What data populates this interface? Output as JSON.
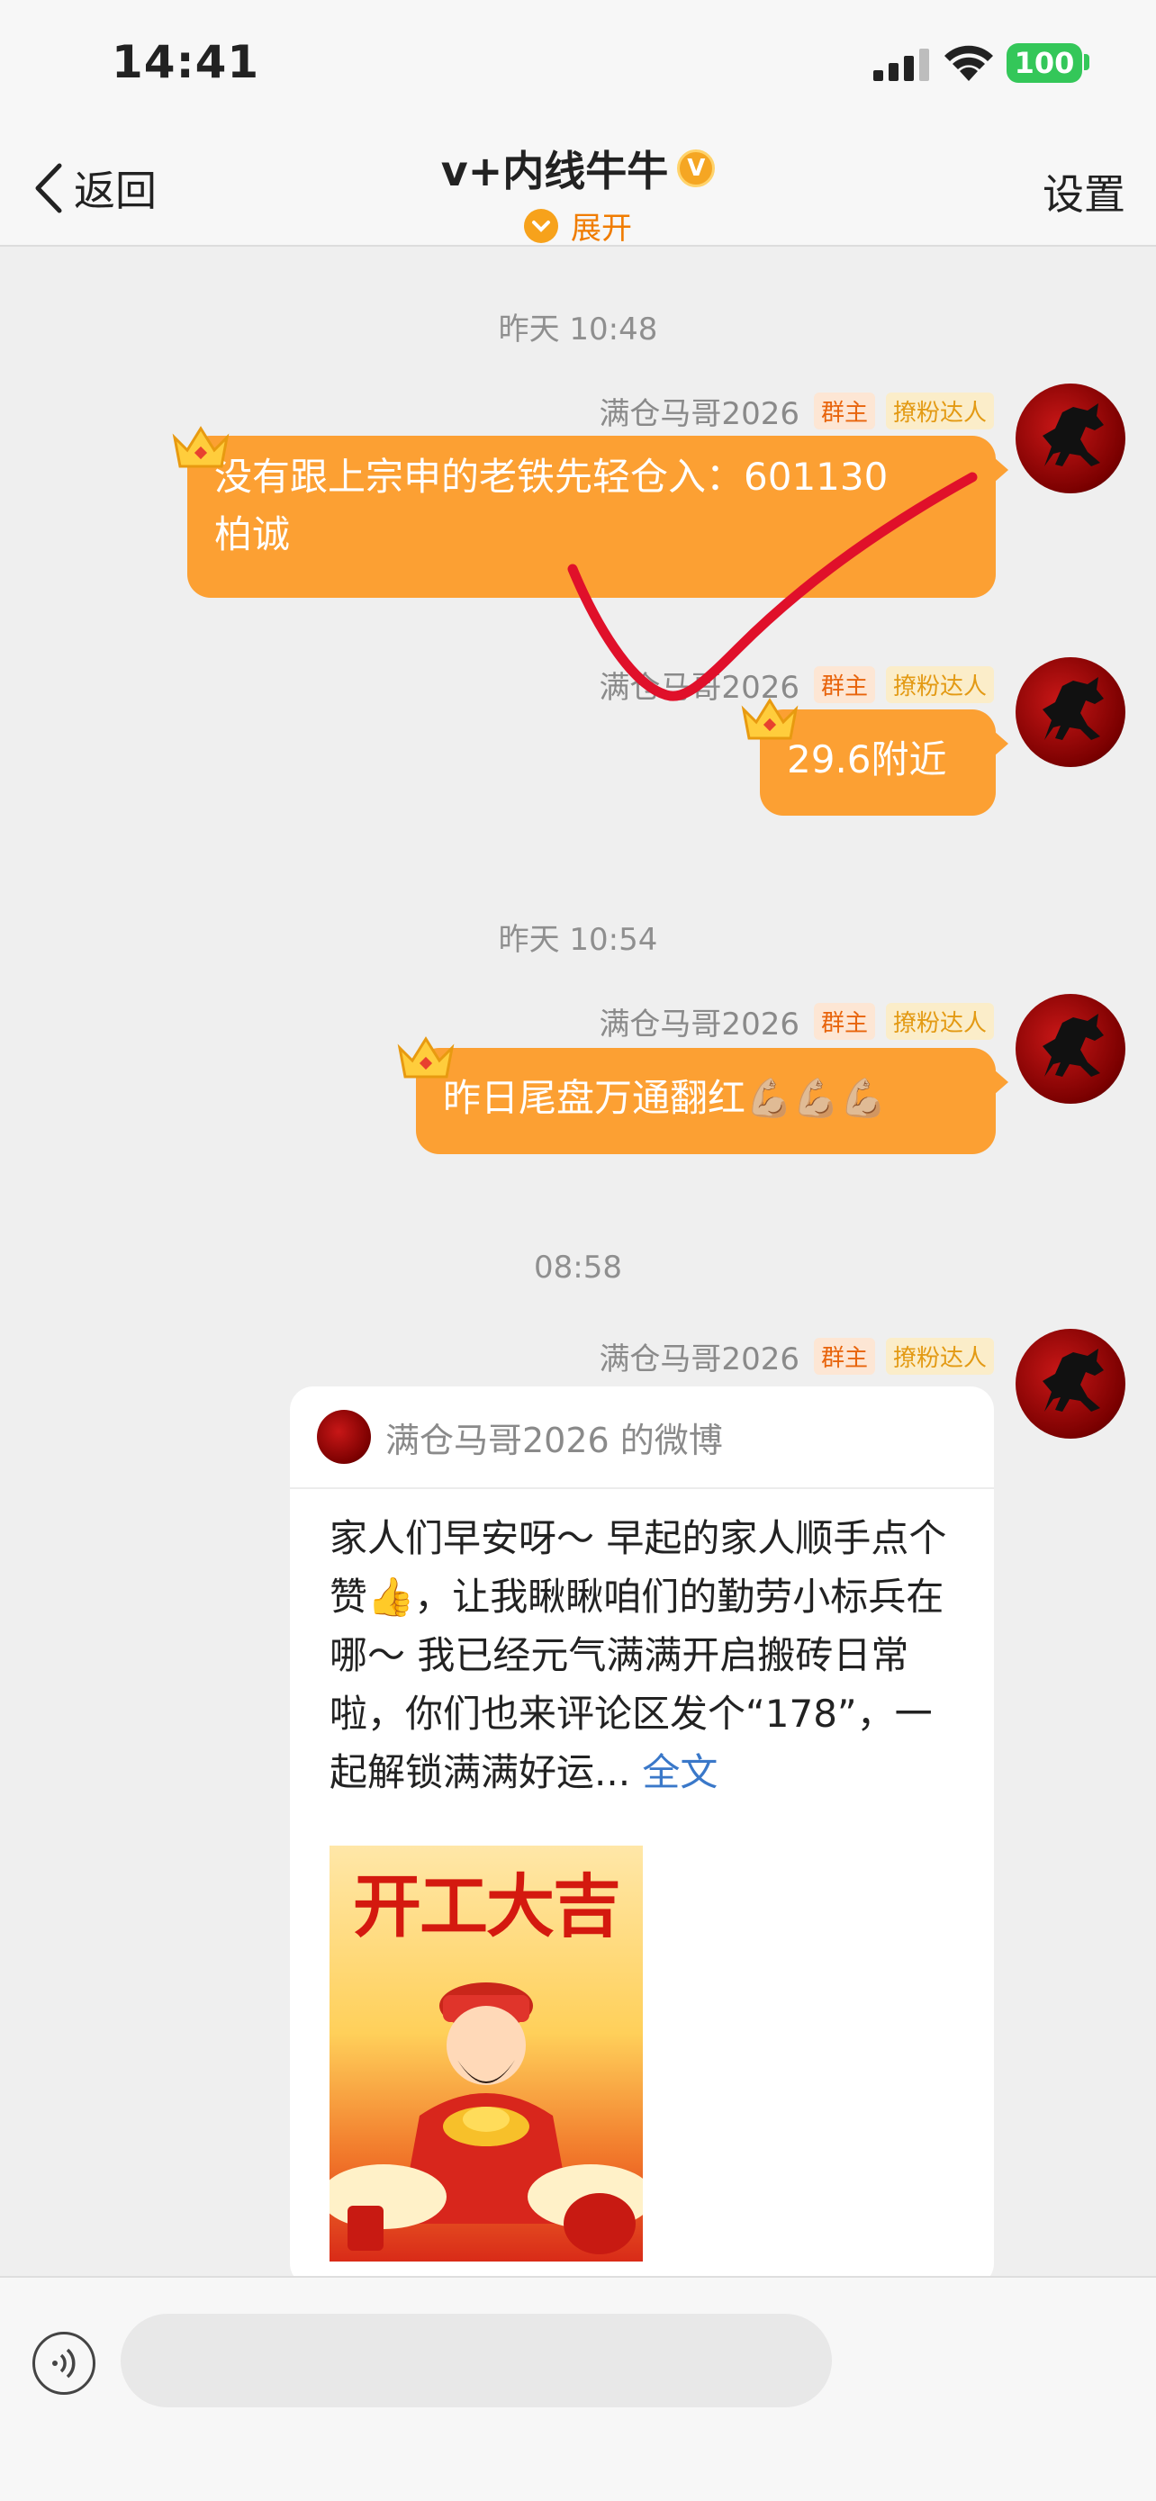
{
  "status_bar": {
    "time": "14:41",
    "battery": "100"
  },
  "nav": {
    "back_label": "返回",
    "title": "v+内线牛牛",
    "expand_label": "展开",
    "settings_label": "设置"
  },
  "chat": {
    "timestamps": [
      "昨天 10:48",
      "昨天 10:54",
      "08:58"
    ],
    "sender": {
      "name": "满仓马哥2026",
      "tag_owner": "群主",
      "tag_fans": "撩粉达人"
    },
    "messages": [
      {
        "line1": "没有跟上宗申的老铁先轻仓入：6011",
        "line1_tail": "30",
        "line2": "柏诚"
      },
      {
        "text": "29.6附近"
      },
      {
        "text": "昨日尾盘万通翻红💪🏼💪🏼💪🏼"
      }
    ],
    "card": {
      "source": "满仓马哥2026 的微博",
      "body": "家人们早安呀～ 早起的家人顺手点个赞👍，让我瞅瞅咱们的勤劳小标兵在哪～ 我已经元气满满开启搬砖日常啦，你们也来评论区发个“178”，一起解锁满满好运...",
      "more_label": "全文",
      "poster_title": "开工大吉"
    }
  },
  "input": {
    "placeholder": ""
  },
  "colors": {
    "bubble": "#fca033",
    "accent": "#f07c00",
    "link": "#3a78c9",
    "annotation": "#e0102a"
  },
  "icons": [
    "signal-icon",
    "wifi-icon",
    "battery-icon",
    "back-chevron-icon",
    "verified-icon",
    "expand-icon",
    "crown-icon",
    "horse-avatar-icon",
    "voice-icon"
  ]
}
